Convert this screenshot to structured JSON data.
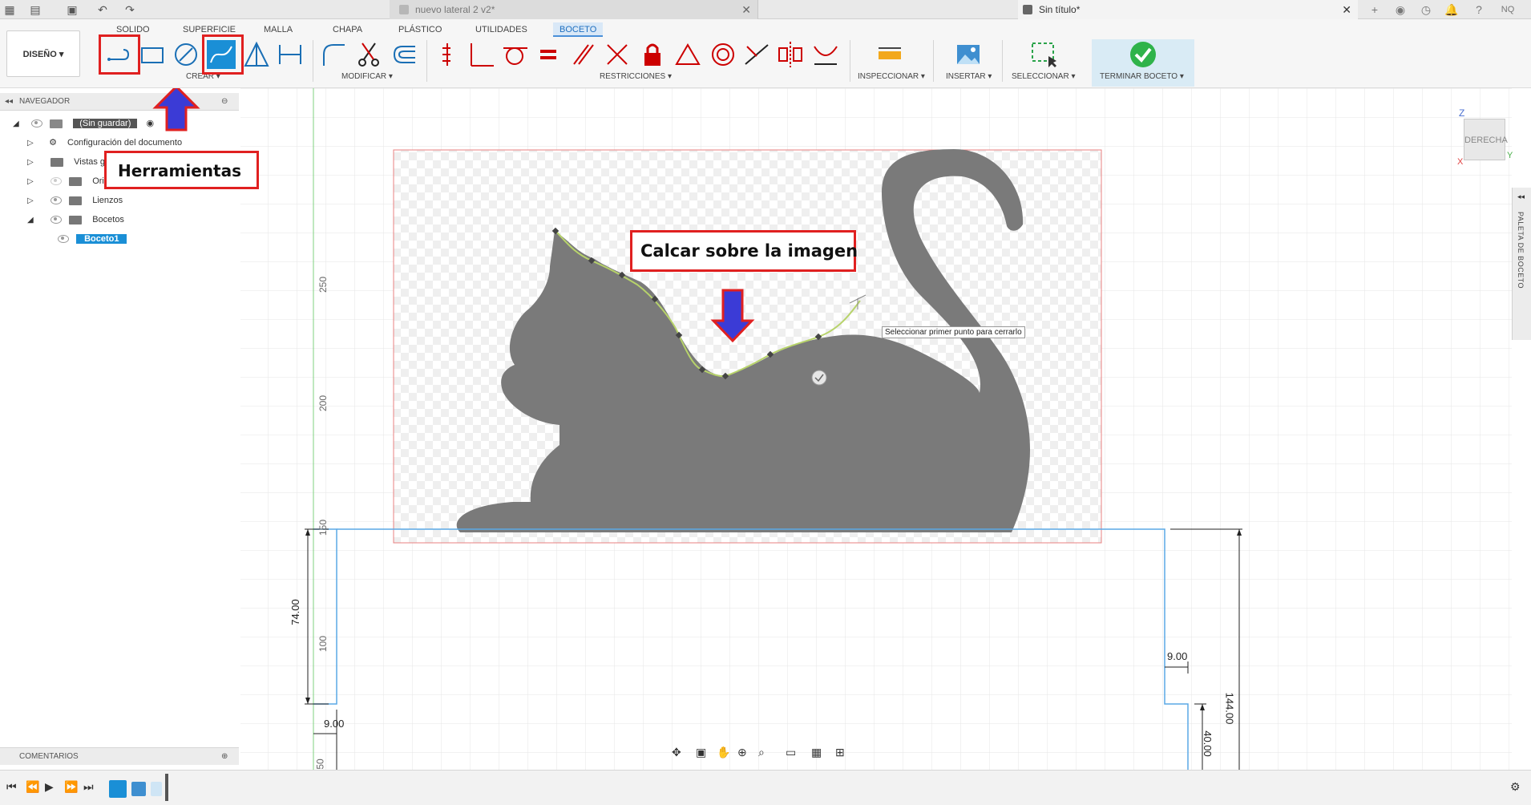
{
  "titlebar": {
    "doc_active": "nuevo lateral 2 v2*",
    "doc_other": "Sin título*",
    "user_initials": "NQ"
  },
  "ribbon": {
    "tabs": [
      "SOLIDO",
      "SUPERFICIE",
      "MALLA",
      "CHAPA",
      "PLÁSTICO",
      "UTILIDADES",
      "BOCETO"
    ],
    "active_tab": "BOCETO",
    "workspace": "DISEÑO",
    "groups": {
      "crear": "CREAR",
      "modificar": "MODIFICAR",
      "restricciones": "RESTRICCIONES",
      "inspeccionar": "INSPECCIONAR",
      "insertar": "INSERTAR",
      "seleccionar": "SELECCIONAR",
      "terminar": "TERMINAR BOCETO"
    }
  },
  "navigator": {
    "title": "NAVEGADOR",
    "root": "(Sin guardar)",
    "items": [
      {
        "label": "Configuración del documento"
      },
      {
        "label": "Vistas guardadas"
      },
      {
        "label": "Origen"
      },
      {
        "label": "Lienzos"
      },
      {
        "label": "Bocetos"
      }
    ],
    "selected": "Boceto1"
  },
  "comments": {
    "title": "COMENTARIOS"
  },
  "annotations": {
    "herramientas": "Herramientas",
    "calcar": "Calcar sobre la imagen"
  },
  "tooltip": "Seleccionar primer punto para cerrarlo",
  "viewcube": {
    "face": "DERECHA",
    "axis_z": "Z",
    "axis_y": "Y",
    "axis_x": "X"
  },
  "paleta": "PALETA DE BOCETO",
  "ruler": [
    "250",
    "200",
    "150",
    "100",
    "50"
  ],
  "dimensions": {
    "left_height": "74.00",
    "left_step": "9.00",
    "right_step": "9.00",
    "right_height": "144.00",
    "right_small": "40.00"
  },
  "colors": {
    "accent": "#1a8fd6",
    "annotation_red": "#e02020",
    "arrow_blue": "#3b3bd6",
    "cat_gray": "#7a7a7a",
    "sketch_blue": "#5aa9e6"
  }
}
